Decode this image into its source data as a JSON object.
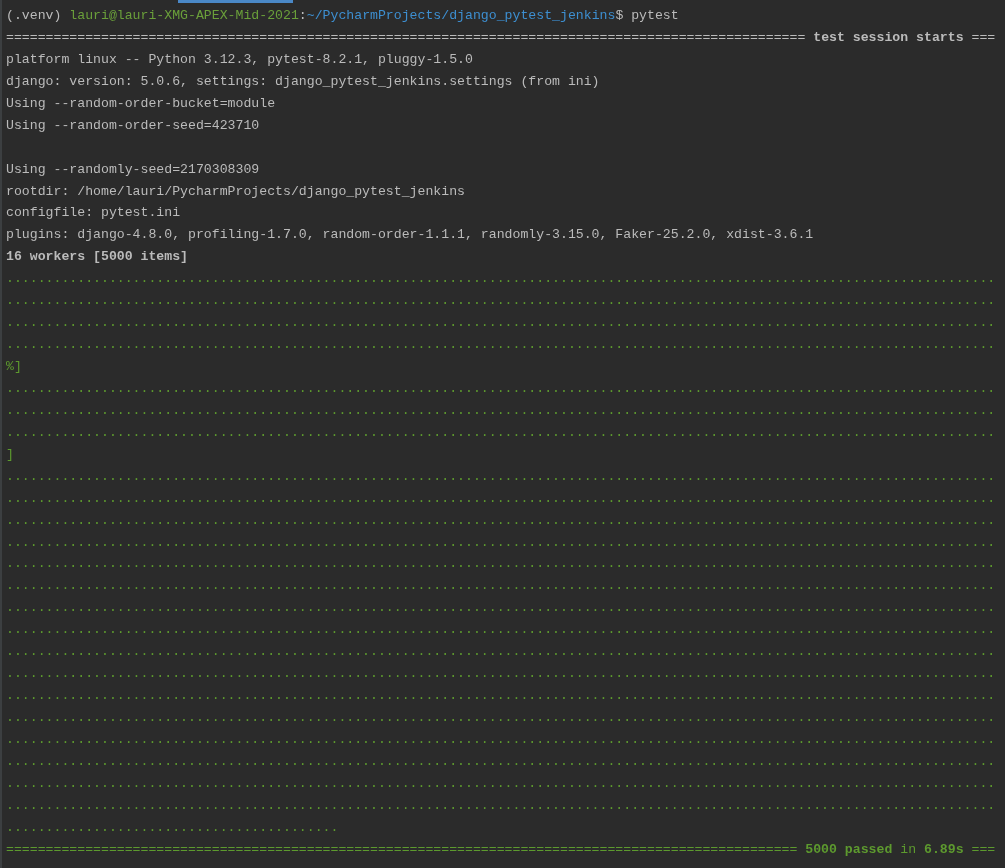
{
  "terminal": {
    "lines": [
      {
        "kind": "text",
        "segments": [
          {
            "text": "(.venv) ",
            "kind": "plain"
          },
          {
            "text": "lauri@lauri-XMG-APEX-Mid-2021",
            "kind": "user"
          },
          {
            "text": ":",
            "kind": "plain"
          },
          {
            "text": "~/PycharmProjects/django_pytest_jenkins",
            "kind": "path"
          },
          {
            "text": "$ pytest",
            "kind": "plain"
          }
        ]
      },
      {
        "kind": "text",
        "segments": [
          {
            "text": "===================================================================================================== ",
            "kind": "plain"
          },
          {
            "text": "test session starts",
            "kind": "bold"
          },
          {
            "text": " ===",
            "kind": "plain"
          }
        ]
      },
      {
        "kind": "text",
        "segments": [
          {
            "text": "platform linux -- Python 3.12.3, pytest-8.2.1, pluggy-1.5.0",
            "kind": "plain"
          }
        ]
      },
      {
        "kind": "text",
        "segments": [
          {
            "text": "django: version: 5.0.6, settings: django_pytest_jenkins.settings (from ini)",
            "kind": "plain"
          }
        ]
      },
      {
        "kind": "text",
        "segments": [
          {
            "text": "Using --random-order-bucket=module",
            "kind": "plain"
          }
        ]
      },
      {
        "kind": "text",
        "segments": [
          {
            "text": "Using --random-order-seed=423710",
            "kind": "plain"
          }
        ]
      },
      {
        "kind": "blank"
      },
      {
        "kind": "text",
        "segments": [
          {
            "text": "Using --randomly-seed=2170308309",
            "kind": "plain"
          }
        ]
      },
      {
        "kind": "text",
        "segments": [
          {
            "text": "rootdir: /home/lauri/PycharmProjects/django_pytest_jenkins",
            "kind": "plain"
          }
        ]
      },
      {
        "kind": "text",
        "segments": [
          {
            "text": "configfile: pytest.ini",
            "kind": "plain"
          }
        ]
      },
      {
        "kind": "text",
        "segments": [
          {
            "text": "plugins: django-4.8.0, profiling-1.7.0, random-order-1.1.1, randomly-3.15.0, Faker-25.2.0, xdist-3.6.1",
            "kind": "plain"
          }
        ]
      },
      {
        "kind": "text",
        "segments": [
          {
            "text": "16 workers [5000 items]",
            "kind": "bold"
          }
        ]
      },
      {
        "kind": "text",
        "segments": [
          {
            "text": ".............................................................................................................................",
            "kind": "progress"
          }
        ]
      },
      {
        "kind": "text",
        "segments": [
          {
            "text": ".............................................................................................................................",
            "kind": "progress"
          }
        ]
      },
      {
        "kind": "text",
        "segments": [
          {
            "text": ".............................................................................................................................",
            "kind": "progress"
          }
        ]
      },
      {
        "kind": "text",
        "segments": [
          {
            "text": ".............................................................................................................................",
            "kind": "progress"
          }
        ]
      },
      {
        "kind": "text",
        "segments": [
          {
            "text": "%]",
            "kind": "progress"
          }
        ]
      },
      {
        "kind": "text",
        "segments": [
          {
            "text": ".............................................................................................................................",
            "kind": "progress"
          }
        ]
      },
      {
        "kind": "text",
        "segments": [
          {
            "text": ".............................................................................................................................",
            "kind": "progress"
          }
        ]
      },
      {
        "kind": "text",
        "segments": [
          {
            "text": ".............................................................................................................................",
            "kind": "progress"
          }
        ]
      },
      {
        "kind": "text",
        "segments": [
          {
            "text": "]",
            "kind": "progress"
          }
        ]
      },
      {
        "kind": "text",
        "segments": [
          {
            "text": ".............................................................................................................................",
            "kind": "progress"
          }
        ]
      },
      {
        "kind": "text",
        "segments": [
          {
            "text": ".............................................................................................................................",
            "kind": "progress"
          }
        ]
      },
      {
        "kind": "text",
        "segments": [
          {
            "text": ".............................................................................................................................",
            "kind": "progress"
          }
        ]
      },
      {
        "kind": "text",
        "segments": [
          {
            "text": ".............................................................................................................................",
            "kind": "progress"
          }
        ]
      },
      {
        "kind": "text",
        "segments": [
          {
            "text": ".............................................................................................................................",
            "kind": "progress"
          }
        ]
      },
      {
        "kind": "text",
        "segments": [
          {
            "text": ".............................................................................................................................",
            "kind": "progress"
          }
        ]
      },
      {
        "kind": "text",
        "segments": [
          {
            "text": ".............................................................................................................................",
            "kind": "progress"
          }
        ]
      },
      {
        "kind": "text",
        "segments": [
          {
            "text": ".............................................................................................................................",
            "kind": "progress"
          }
        ]
      },
      {
        "kind": "text",
        "segments": [
          {
            "text": ".............................................................................................................................",
            "kind": "progress"
          }
        ]
      },
      {
        "kind": "text",
        "segments": [
          {
            "text": ".............................................................................................................................",
            "kind": "progress"
          }
        ]
      },
      {
        "kind": "text",
        "segments": [
          {
            "text": ".............................................................................................................................",
            "kind": "progress"
          }
        ]
      },
      {
        "kind": "text",
        "segments": [
          {
            "text": ".............................................................................................................................",
            "kind": "progress"
          }
        ]
      },
      {
        "kind": "text",
        "segments": [
          {
            "text": ".............................................................................................................................",
            "kind": "progress"
          }
        ]
      },
      {
        "kind": "text",
        "segments": [
          {
            "text": ".............................................................................................................................",
            "kind": "progress"
          }
        ]
      },
      {
        "kind": "text",
        "segments": [
          {
            "text": ".............................................................................................................................",
            "kind": "progress"
          }
        ]
      },
      {
        "kind": "text",
        "segments": [
          {
            "text": ".............................................................................................................................",
            "kind": "progress"
          }
        ]
      },
      {
        "kind": "text",
        "segments": [
          {
            "text": "..........................................",
            "kind": "progress"
          }
        ]
      },
      {
        "kind": "text",
        "segments": [
          {
            "text": "==================================================================================================== ",
            "kind": "success"
          },
          {
            "text": "5000 passed",
            "kind": "success-bold"
          },
          {
            "text": " in ",
            "kind": "success"
          },
          {
            "text": "6.89s",
            "kind": "success-bold"
          },
          {
            "text": " ===",
            "kind": "success"
          }
        ]
      }
    ]
  }
}
